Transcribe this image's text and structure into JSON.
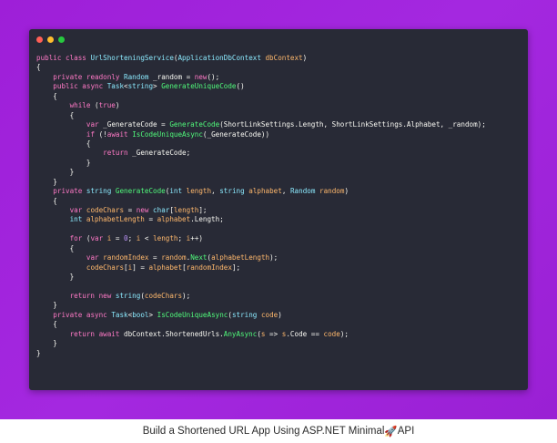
{
  "window": {
    "controls": [
      {
        "name": "close-dot",
        "color": "#ff5f56"
      },
      {
        "name": "minimize-dot",
        "color": "#ffbd2e"
      },
      {
        "name": "maximize-dot",
        "color": "#27c93f"
      }
    ]
  },
  "code": {
    "lines": [
      [
        [
          "kw",
          "public "
        ],
        [
          "kw",
          "class "
        ],
        [
          "ty",
          "UrlShorteningService"
        ],
        [
          "pl",
          "("
        ],
        [
          "ty",
          "ApplicationDbContext "
        ],
        [
          "pm",
          "dbContext"
        ],
        [
          "pl",
          ")"
        ]
      ],
      [
        [
          "pl",
          "{"
        ]
      ],
      [
        [
          "pl",
          "    "
        ],
        [
          "kw",
          "private readonly "
        ],
        [
          "ty",
          "Random "
        ],
        [
          "pl",
          "_random = "
        ],
        [
          "kw",
          "new"
        ],
        [
          "pl",
          "();"
        ]
      ],
      [
        [
          "pl",
          "    "
        ],
        [
          "kw",
          "public async "
        ],
        [
          "ty",
          "Task"
        ],
        [
          "pl",
          "<"
        ],
        [
          "ty",
          "string"
        ],
        [
          "pl",
          "> "
        ],
        [
          "fn",
          "GenerateUniqueCode"
        ],
        [
          "pl",
          "()"
        ]
      ],
      [
        [
          "pl",
          "    {"
        ]
      ],
      [
        [
          "pl",
          "        "
        ],
        [
          "kw",
          "while "
        ],
        [
          "pl",
          "("
        ],
        [
          "kw",
          "true"
        ],
        [
          "pl",
          ")"
        ]
      ],
      [
        [
          "pl",
          "        {"
        ]
      ],
      [
        [
          "pl",
          "            "
        ],
        [
          "kw",
          "var "
        ],
        [
          "pl",
          "_GenerateCode = "
        ],
        [
          "fn",
          "GenerateCode"
        ],
        [
          "pl",
          "(ShortLinkSettings.Length, ShortLinkSettings.Alphabet, _random);"
        ]
      ],
      [
        [
          "pl",
          "            "
        ],
        [
          "kw",
          "if "
        ],
        [
          "pl",
          "(!"
        ],
        [
          "kw",
          "await "
        ],
        [
          "fn",
          "IsCodeUniqueAsync"
        ],
        [
          "pl",
          "(_GenerateCode))"
        ]
      ],
      [
        [
          "pl",
          "            {"
        ]
      ],
      [
        [
          "pl",
          "                "
        ],
        [
          "kw",
          "return "
        ],
        [
          "pl",
          "_GenerateCode;"
        ]
      ],
      [
        [
          "pl",
          "            }"
        ]
      ],
      [
        [
          "pl",
          "        }"
        ]
      ],
      [
        [
          "pl",
          "    }"
        ]
      ],
      [
        [
          "pl",
          "    "
        ],
        [
          "kw",
          "private "
        ],
        [
          "ty",
          "string "
        ],
        [
          "fn",
          "GenerateCode"
        ],
        [
          "pl",
          "("
        ],
        [
          "ty",
          "int "
        ],
        [
          "pm",
          "length"
        ],
        [
          "pl",
          ", "
        ],
        [
          "ty",
          "string "
        ],
        [
          "pm",
          "alphabet"
        ],
        [
          "pl",
          ", "
        ],
        [
          "ty",
          "Random "
        ],
        [
          "pm",
          "random"
        ],
        [
          "pl",
          ")"
        ]
      ],
      [
        [
          "pl",
          "    {"
        ]
      ],
      [
        [
          "pl",
          "        "
        ],
        [
          "kw",
          "var "
        ],
        [
          "pm",
          "codeChars"
        ],
        [
          "pl",
          " = "
        ],
        [
          "kw",
          "new "
        ],
        [
          "ty",
          "char"
        ],
        [
          "pl",
          "["
        ],
        [
          "pm",
          "length"
        ],
        [
          "pl",
          "];"
        ]
      ],
      [
        [
          "pl",
          "        "
        ],
        [
          "ty",
          "int "
        ],
        [
          "pm",
          "alphabetLength"
        ],
        [
          "pl",
          " = "
        ],
        [
          "pm",
          "alphabet"
        ],
        [
          "pl",
          ".Length;"
        ]
      ],
      [
        [
          "pl",
          ""
        ]
      ],
      [
        [
          "pl",
          "        "
        ],
        [
          "kw",
          "for "
        ],
        [
          "pl",
          "("
        ],
        [
          "kw",
          "var "
        ],
        [
          "pm",
          "i"
        ],
        [
          "pl",
          " = "
        ],
        [
          "nm",
          "0"
        ],
        [
          "pl",
          "; "
        ],
        [
          "pm",
          "i"
        ],
        [
          "pl",
          " < "
        ],
        [
          "pm",
          "length"
        ],
        [
          "pl",
          "; "
        ],
        [
          "pm",
          "i"
        ],
        [
          "pl",
          "++)"
        ]
      ],
      [
        [
          "pl",
          "        {"
        ]
      ],
      [
        [
          "pl",
          "            "
        ],
        [
          "kw",
          "var "
        ],
        [
          "pm",
          "randomIndex"
        ],
        [
          "pl",
          " = "
        ],
        [
          "pm",
          "random"
        ],
        [
          "pl",
          "."
        ],
        [
          "fn",
          "Next"
        ],
        [
          "pl",
          "("
        ],
        [
          "pm",
          "alphabetLength"
        ],
        [
          "pl",
          ");"
        ]
      ],
      [
        [
          "pl",
          "            "
        ],
        [
          "pm",
          "codeChars"
        ],
        [
          "pl",
          "["
        ],
        [
          "pm",
          "i"
        ],
        [
          "pl",
          "] = "
        ],
        [
          "pm",
          "alphabet"
        ],
        [
          "pl",
          "["
        ],
        [
          "pm",
          "randomIndex"
        ],
        [
          "pl",
          "];"
        ]
      ],
      [
        [
          "pl",
          "        }"
        ]
      ],
      [
        [
          "pl",
          ""
        ]
      ],
      [
        [
          "pl",
          "        "
        ],
        [
          "kw",
          "return new "
        ],
        [
          "ty",
          "string"
        ],
        [
          "pl",
          "("
        ],
        [
          "pm",
          "codeChars"
        ],
        [
          "pl",
          ");"
        ]
      ],
      [
        [
          "pl",
          "    }"
        ]
      ],
      [
        [
          "pl",
          "    "
        ],
        [
          "kw",
          "private async "
        ],
        [
          "ty",
          "Task"
        ],
        [
          "pl",
          "<"
        ],
        [
          "ty",
          "bool"
        ],
        [
          "pl",
          "> "
        ],
        [
          "fn",
          "IsCodeUniqueAsync"
        ],
        [
          "pl",
          "("
        ],
        [
          "ty",
          "string "
        ],
        [
          "pm",
          "code"
        ],
        [
          "pl",
          ")"
        ]
      ],
      [
        [
          "pl",
          "    {"
        ]
      ],
      [
        [
          "pl",
          "        "
        ],
        [
          "kw",
          "return await "
        ],
        [
          "pl",
          "dbContext.ShortenedUrls."
        ],
        [
          "fn",
          "AnyAsync"
        ],
        [
          "pl",
          "("
        ],
        [
          "pm",
          "s"
        ],
        [
          "pl",
          " => "
        ],
        [
          "pm",
          "s"
        ],
        [
          "pl",
          ".Code == "
        ],
        [
          "pm",
          "code"
        ],
        [
          "pl",
          ");"
        ]
      ],
      [
        [
          "pl",
          "    }"
        ]
      ],
      [
        [
          "pl",
          "}"
        ]
      ]
    ]
  },
  "caption": {
    "before": "Build a Shortened URL App Using ASP.NET Minimal ",
    "emoji": "🚀",
    "after": "API"
  }
}
